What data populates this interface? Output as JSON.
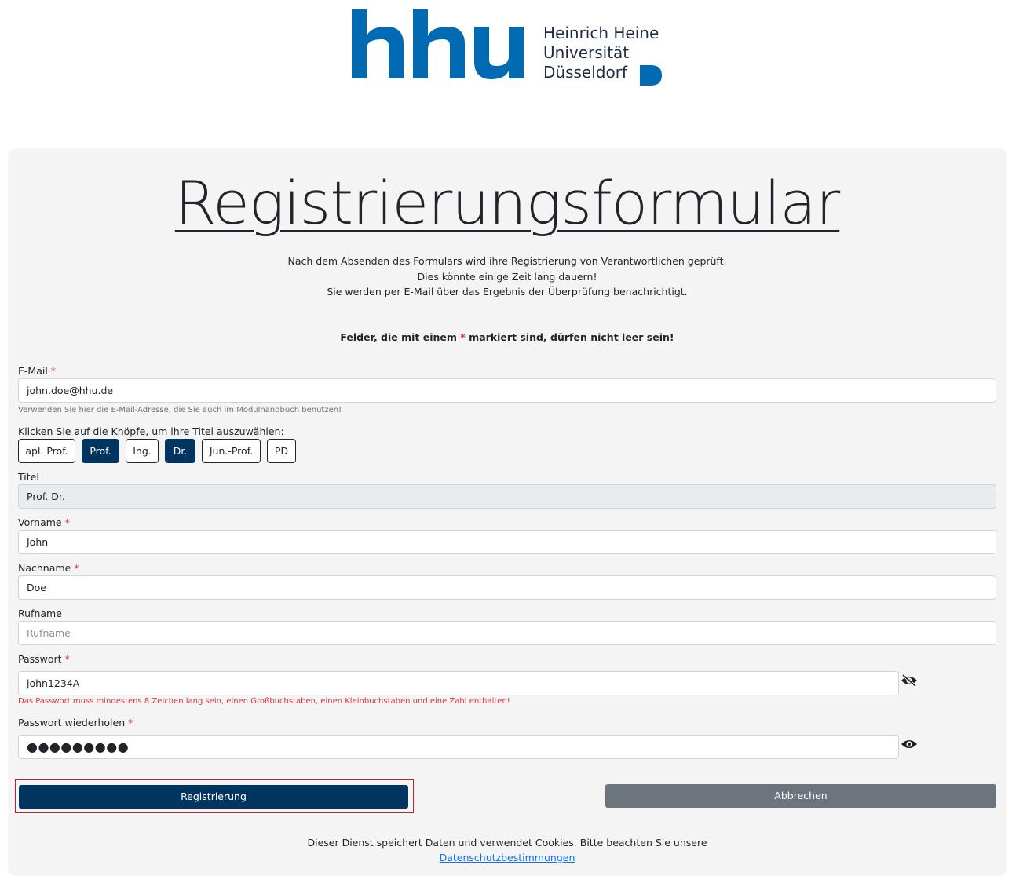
{
  "logo": {
    "letters": "hhu",
    "line1": "Heinrich Heine",
    "line2": "Universität",
    "line3": "Düsseldorf",
    "brand_color": "#006ab3"
  },
  "form": {
    "title": "Registrierungsformular",
    "intro": [
      "Nach dem Absenden des Formulars wird ihre Registrierung von Verantwortlichen geprüft.",
      "Dies könnte einige Zeit lang dauern!",
      "Sie werden per E-Mail über das Ergebnis der Überprüfung benachrichtigt."
    ],
    "required_note_before": "Felder, die mit einem",
    "required_star": "*",
    "required_note_after": "markiert sind, dürfen nicht leer sein!"
  },
  "email": {
    "label": "E-Mail",
    "value": "john.doe@hhu.de",
    "help": "Verwenden Sie hier die E-Mail-Adresse, die Sie auch im Modulhandbuch benutzen!"
  },
  "titles": {
    "prompt": "Klicken Sie auf die Knöpfe, um ihre Titel auszuwählen:",
    "buttons": [
      {
        "label": "apl. Prof.",
        "active": false
      },
      {
        "label": "Prof.",
        "active": true
      },
      {
        "label": "Ing.",
        "active": false
      },
      {
        "label": "Dr.",
        "active": true
      },
      {
        "label": "Jun.-Prof.",
        "active": false
      },
      {
        "label": "PD",
        "active": false
      }
    ],
    "field_label": "Titel",
    "field_value": "Prof. Dr."
  },
  "vorname": {
    "label": "Vorname",
    "value": "John"
  },
  "nachname": {
    "label": "Nachname",
    "value": "Doe"
  },
  "rufname": {
    "label": "Rufname",
    "placeholder": "Rufname"
  },
  "passwort": {
    "label": "Passwort",
    "value": "john1234A",
    "error": "Das Passwort muss mindestens 8 Zeichen lang sein, einen Großbuchstaben, einen Kleinbuchstaben und eine Zahl enthalten!",
    "toggle_icon": "eye-slash-icon"
  },
  "passwort_wdh": {
    "label": "Passwort wiederholen",
    "value": "●●●●●●●●●",
    "toggle_icon": "eye-icon"
  },
  "actions": {
    "register_label": "Registrierung",
    "cancel_label": "Abbrechen"
  },
  "footer": {
    "text": "Dieser Dienst speichert Daten und verwendet Cookies. Bitte beachten Sie unsere",
    "link": "Datenschutzbestimmungen"
  },
  "colors": {
    "primary": "#003560",
    "secondary": "#6c757d",
    "error": "#dc3545",
    "card_bg": "#f4f4f4"
  }
}
